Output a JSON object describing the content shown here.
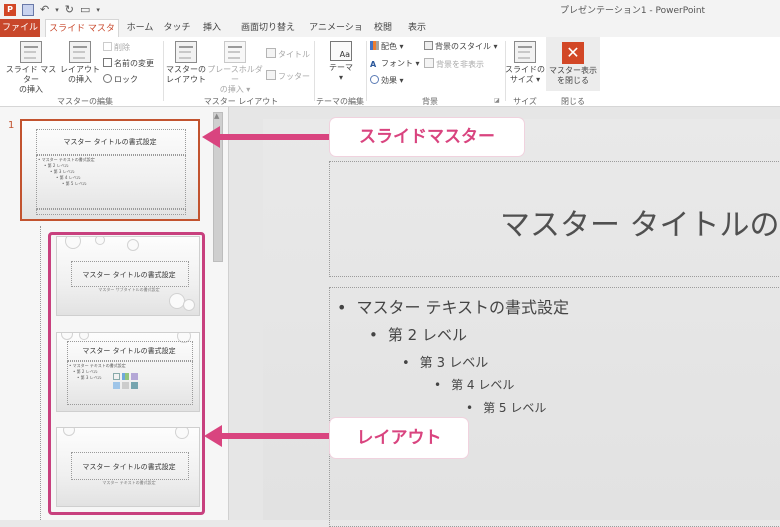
{
  "window": {
    "title": "プレゼンテーション1 - PowerPoint",
    "app_icon": "P"
  },
  "tabs": [
    "ファイル",
    "スライド マスター",
    "ホーム",
    "タッチ",
    "挿入",
    "画面切り替え",
    "アニメーション",
    "校閲",
    "表示"
  ],
  "ribbon": {
    "insert_master": [
      "スライド マスター",
      "の挿入"
    ],
    "insert_layout": [
      "レイアウト",
      "の挿入"
    ],
    "delete": "削除",
    "rename": "名前の変更",
    "preserve": "ロック",
    "group_edit_master": "マスターの編集",
    "master_layout": [
      "マスターの",
      "レイアウト"
    ],
    "insert_placeholder": [
      "プレースホルダー",
      "の挿入 ▾"
    ],
    "chk_title": "タイトル",
    "chk_footer": "フッター",
    "group_master_layout": "マスター レイアウト",
    "themes": "テーマ",
    "group_edit_theme": "テーマの編集",
    "colors": "配色 ▾",
    "fonts": "フォント ▾",
    "effects": "効果 ▾",
    "bg_styles": "背景のスタイル ▾",
    "hide_bg": "背景を非表示",
    "group_background": "背景",
    "slide_size": [
      "スライドの",
      "サイズ ▾"
    ],
    "group_size": "サイズ",
    "close_master": [
      "マスター表示",
      "を閉じる"
    ],
    "group_close": "閉じる",
    "accent_color": "#d24726"
  },
  "panel": {
    "slide_number": "1",
    "master_thumb": {
      "title": "マスター タイトルの書式設定",
      "lines": [
        "• マスター テキストの書式設定",
        "• 第 2 レベル",
        "• 第 3 レベル",
        "• 第 4 レベル",
        "• 第 5 レベル"
      ]
    },
    "layout1": {
      "title": "マスター タイトルの書式設定",
      "sub": "マスター サブタイトルの書式設定"
    },
    "layout2": {
      "title": "マスター タイトルの書式設定",
      "lines": [
        "• マスター テキストの書式設定",
        "• 第 2 レベル",
        "• 第 3 レベル"
      ]
    },
    "layout3": {
      "title": "マスター タイトルの書式設定",
      "sub": "マスター テキストの書式設定"
    }
  },
  "slide": {
    "title": "マスター タイトルの書式設定",
    "levels": [
      "マスター テキストの書式設定",
      "第 2 レベル",
      "第 3 レベル",
      "第 4 レベル",
      "第 5 レベル"
    ]
  },
  "callouts": {
    "master": "スライドマスター",
    "layout": "レイアウト",
    "color": "#d9447f"
  }
}
